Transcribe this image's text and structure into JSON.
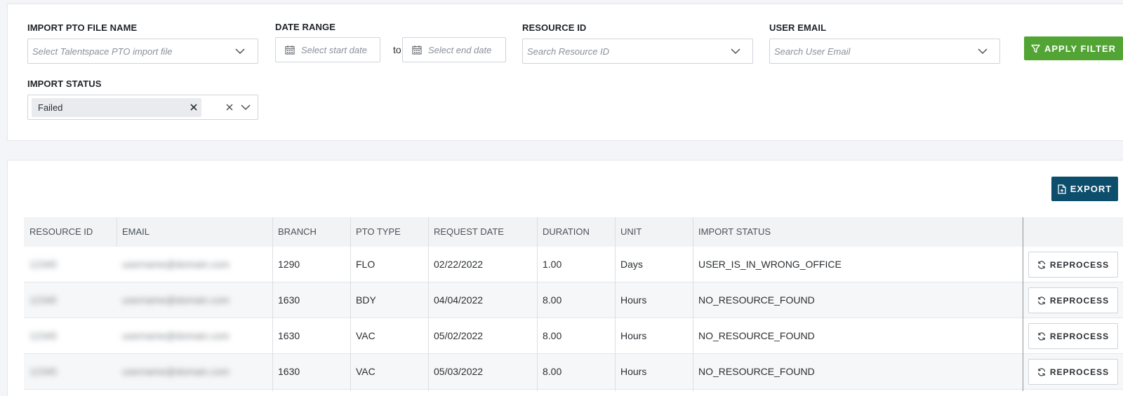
{
  "filters": {
    "file_name": {
      "label": "IMPORT PTO FILE NAME",
      "placeholder": "Select Talentspace PTO import file"
    },
    "date_range": {
      "label": "DATE RANGE",
      "start_placeholder": "Select start date",
      "to_label": "to",
      "end_placeholder": "Select end date"
    },
    "resource_id": {
      "label": "RESOURCE ID",
      "placeholder": "Search Resource ID"
    },
    "user_email": {
      "label": "USER EMAIL",
      "placeholder": "Search User Email"
    },
    "import_status": {
      "label": "IMPORT STATUS",
      "selected": "Failed"
    },
    "apply_label": "APPLY FILTER"
  },
  "export_label": "EXPORT",
  "table": {
    "headers": [
      "RESOURCE ID",
      "EMAIL",
      "BRANCH",
      "PTO TYPE",
      "REQUEST DATE",
      "DURATION",
      "UNIT",
      "IMPORT STATUS"
    ],
    "reprocess_label": "REPROCESS",
    "rows": [
      {
        "resource_id": "12345",
        "email": "username@domain.com",
        "branch": "1290",
        "pto_type": "FLO",
        "request_date": "02/22/2022",
        "duration": "1.00",
        "unit": "Days",
        "import_status": "USER_IS_IN_WRONG_OFFICE"
      },
      {
        "resource_id": "12345",
        "email": "username@domain.com",
        "branch": "1630",
        "pto_type": "BDY",
        "request_date": "04/04/2022",
        "duration": "8.00",
        "unit": "Hours",
        "import_status": "NO_RESOURCE_FOUND"
      },
      {
        "resource_id": "12345",
        "email": "username@domain.com",
        "branch": "1630",
        "pto_type": "VAC",
        "request_date": "05/02/2022",
        "duration": "8.00",
        "unit": "Hours",
        "import_status": "NO_RESOURCE_FOUND"
      },
      {
        "resource_id": "12345",
        "email": "username@domain.com",
        "branch": "1630",
        "pto_type": "VAC",
        "request_date": "05/03/2022",
        "duration": "8.00",
        "unit": "Hours",
        "import_status": "NO_RESOURCE_FOUND"
      }
    ]
  },
  "colors": {
    "apply_button": "#52a534",
    "export_button": "#0d4e6c"
  }
}
